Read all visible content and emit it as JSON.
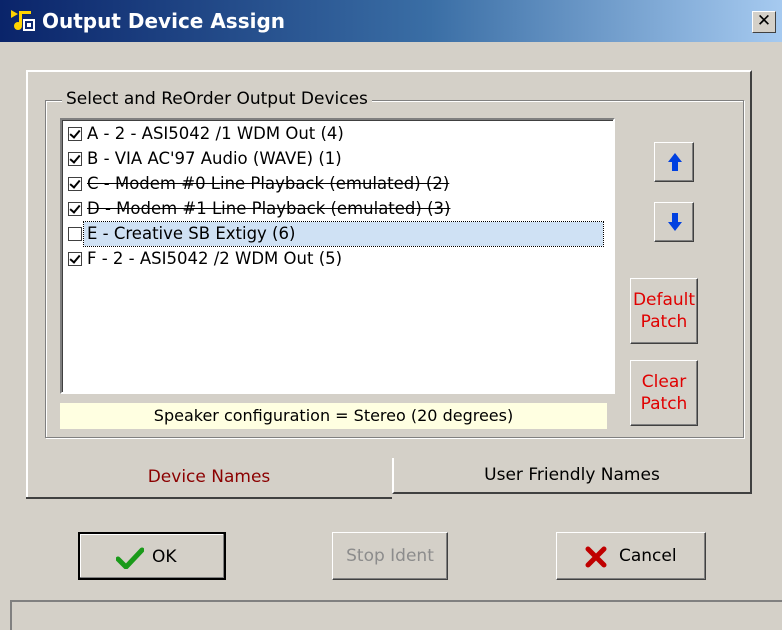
{
  "window": {
    "title": "Output Device Assign",
    "close_symbol": "✕",
    "icon": "music-app-icon"
  },
  "group": {
    "legend": "Select and ReOrder Output Devices"
  },
  "devices": [
    {
      "label": "A  - 2 - ASI5042 /1 WDM Out (4)",
      "checked": true,
      "strikethrough": false,
      "selected": false
    },
    {
      "label": "B  - VIA AC'97 Audio (WAVE) (1)",
      "checked": true,
      "strikethrough": false,
      "selected": false
    },
    {
      "label": "C  - Modem #0 Line Playback (emulated) (2)",
      "checked": true,
      "strikethrough": true,
      "selected": false
    },
    {
      "label": "D  - Modem #1 Line Playback (emulated) (3)",
      "checked": true,
      "strikethrough": true,
      "selected": false
    },
    {
      "label": "E  - Creative SB Extigy (6)",
      "checked": false,
      "strikethrough": false,
      "selected": true
    },
    {
      "label": "F  - 2 - ASI5042 /2 WDM Out (5)",
      "checked": true,
      "strikethrough": false,
      "selected": false
    }
  ],
  "speaker_config": "Speaker configuration = Stereo (20 degrees)",
  "buttons": {
    "move_up_icon": "arrow-up-icon",
    "move_down_icon": "arrow-down-icon",
    "default_patch": "Default Patch",
    "default_patch_line1": "Default",
    "default_patch_line2": "Patch",
    "clear_patch_line1": "Clear",
    "clear_patch_line2": "Patch",
    "ok": "OK",
    "stop_ident": "Stop Ident",
    "cancel": "Cancel"
  },
  "tabs": [
    {
      "label": "Device Names",
      "active": true
    },
    {
      "label": "User Friendly Names",
      "active": false
    }
  ],
  "colors": {
    "title_gradient_start": "#0a246a",
    "title_gradient_end": "#a6caf0",
    "arrow_blue": "#0040e0",
    "patch_text": "#e00000",
    "active_tab_text": "#8b0000",
    "ok_check": "#1a9a1a",
    "cancel_x": "#c00000",
    "speaker_bg": "#ffffe1",
    "selected_item_bg": "#cfe1f4"
  }
}
